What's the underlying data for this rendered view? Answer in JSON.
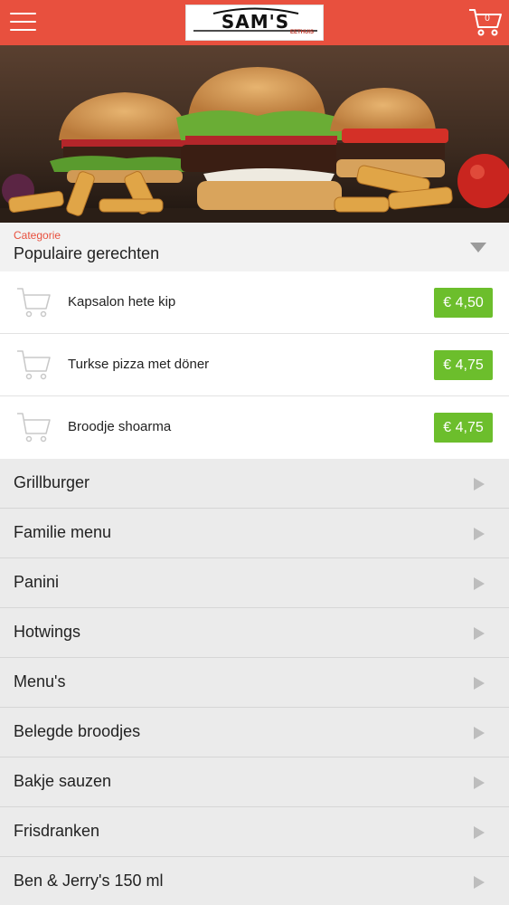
{
  "header": {
    "logo_text": "SAM'S",
    "logo_subtext": "EETHUIS",
    "cart_count": "0",
    "menu_icon": "hamburger-icon",
    "cart_icon": "cart-icon"
  },
  "hero": {
    "image": "burgers-and-fries-photo"
  },
  "category": {
    "label": "Categorie",
    "selected": "Populaire gerechten"
  },
  "popular_items": [
    {
      "name": "Kapsalon hete kip",
      "price": "€ 4,50"
    },
    {
      "name": "Turkse pizza met döner",
      "price": "€ 4,75"
    },
    {
      "name": "Broodje shoarma",
      "price": "€ 4,75"
    }
  ],
  "categories": [
    "Grillburger",
    "Familie menu",
    "Panini",
    "Hotwings",
    "Menu's",
    "Belegde broodjes",
    "Bakje sauzen",
    "Frisdranken",
    "Ben & Jerry's 150 ml"
  ],
  "colors": {
    "header": "#e8503e",
    "price_badge": "#6cbe2c",
    "category_label": "#e8503e"
  }
}
